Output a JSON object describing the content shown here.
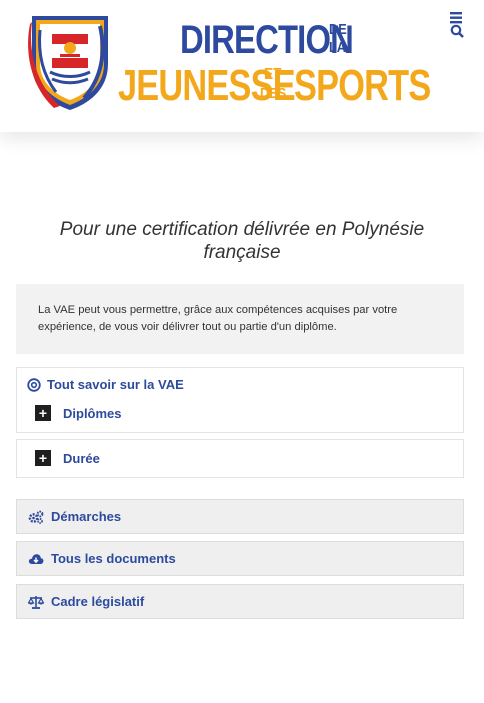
{
  "header": {
    "logo": {
      "line1": "DIRECTION",
      "de": "DE",
      "la": "LA",
      "line2": "JEUNESSE",
      "et": "ET",
      "des": "DES",
      "sports": "SPORTS"
    },
    "menu_icon": "hamburger-icon",
    "search_icon": "search-icon"
  },
  "subtitle": "Pour une certification délivrée en Polynésie française",
  "intro": "La VAE peut vous permettre, grâce aux compétences acquises par votre expérience, de vous voir délivrer tout ou partie d'un diplôme.",
  "accordion": {
    "title": "Tout savoir sur la VAE",
    "items": [
      {
        "label": "Diplômes",
        "toggle": "+"
      },
      {
        "label": "Durée",
        "toggle": "+"
      }
    ]
  },
  "links": [
    {
      "label": "Démarches",
      "icon": "gears-icon"
    },
    {
      "label": "Tous les documents",
      "icon": "cloud-download-icon"
    },
    {
      "label": "Cadre législatif",
      "icon": "scale-icon"
    }
  ],
  "colors": {
    "brand_blue": "#2e4a9e",
    "brand_orange": "#f3a81c"
  }
}
